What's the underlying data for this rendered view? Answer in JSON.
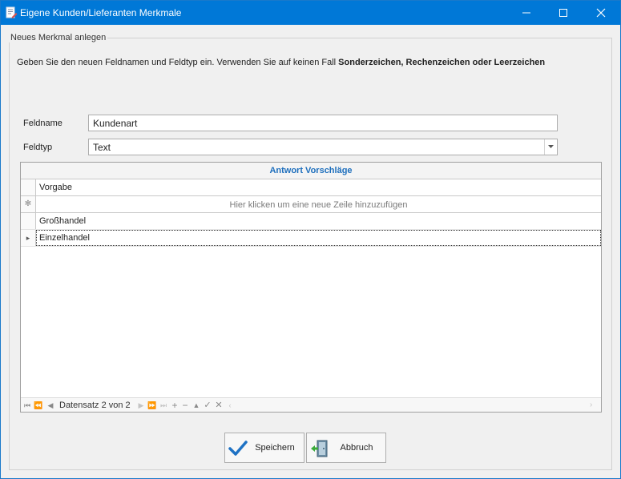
{
  "window": {
    "title": "Eigene Kunden/Lieferanten Merkmale",
    "icon": "document-edit-icon",
    "controls": {
      "minimize": "minimize-icon",
      "maximize": "maximize-icon",
      "close": "close-icon"
    },
    "accent_color": "#0078d7"
  },
  "group": {
    "legend": "Neues Merkmal anlegen",
    "instructions_prefix": "Geben Sie den neuen Feldnamen und Feldtyp ein. Verwenden Sie auf keinen Fall ",
    "instructions_bold": "Sonderzeichen, Rechenzeichen oder Leerzeichen"
  },
  "form": {
    "feldname_label": "Feldname",
    "feldname_value": "Kundenart",
    "feldtyp_label": "Feldtyp",
    "feldtyp_value": "Text"
  },
  "grid": {
    "caption": "Antwort Vorschläge",
    "column_header": "Vorgabe",
    "new_row_marker": "✻",
    "new_row_text": "Hier klicken um eine neue Zeile hinzuzufügen",
    "rows": [
      {
        "value": "Großhandel"
      },
      {
        "value": "Einzelhandel"
      }
    ],
    "current_row_marker": "▸",
    "navigator": {
      "record_text": "Datensatz 2 von 2"
    }
  },
  "buttons": {
    "save_label": "Speichern",
    "save_icon": "checkmark-icon",
    "cancel_label": "Abbruch",
    "cancel_icon": "exit-door-icon"
  }
}
